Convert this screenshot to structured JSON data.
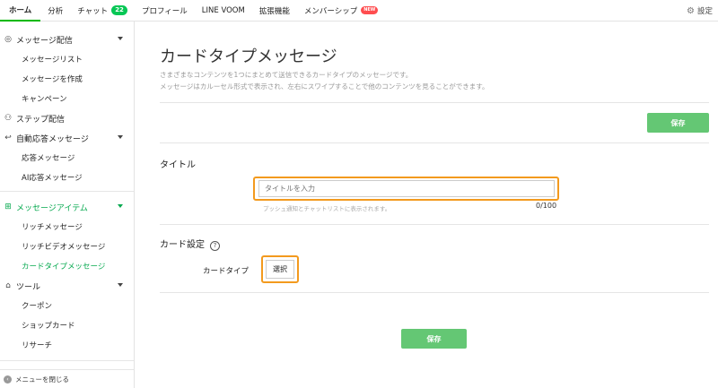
{
  "topnav": {
    "tabs": [
      {
        "label": "ホーム"
      },
      {
        "label": "分析"
      },
      {
        "label": "チャット",
        "badge": "22"
      },
      {
        "label": "プロフィール"
      },
      {
        "label": "LINE VOOM"
      },
      {
        "label": "拡張機能"
      },
      {
        "label": "メンバーシップ",
        "badge": "NEW"
      }
    ],
    "settings_label": "設定"
  },
  "sidebar": {
    "groups": [
      {
        "label": "メッセージ配信",
        "items": [
          "メッセージリスト",
          "メッセージを作成",
          "キャンペーン"
        ]
      },
      {
        "label": "ステップ配信"
      },
      {
        "label": "自動応答メッセージ",
        "items": [
          "応答メッセージ",
          "AI応答メッセージ"
        ]
      },
      {
        "label": "メッセージアイテム",
        "items": [
          "リッチメッセージ",
          "リッチビデオメッセージ",
          "カードタイプメッセージ"
        ]
      },
      {
        "label": "ツール",
        "items": [
          "クーポン",
          "ショップカード",
          "リサーチ"
        ]
      }
    ],
    "close_menu": "メニューを閉じる"
  },
  "main": {
    "title": "カードタイプメッセージ",
    "description": [
      "さまざまなコンテンツを1つにまとめて送信できるカードタイプのメッセージです。",
      "メッセージはカルーセル形式で表示され、左右にスワイプすることで他のコンテンツを見ることができます。"
    ],
    "save_label": "保存",
    "title_section": {
      "heading": "タイトル",
      "placeholder": "タイトルを入力",
      "hint": "プッシュ通知とチャットリストに表示されます。",
      "counter": "0/100"
    },
    "card_section": {
      "heading": "カード設定",
      "card_type_label": "カードタイプ",
      "select_label": "選択"
    },
    "footer_save_label": "保存"
  },
  "colors": {
    "brand_green": "#06c755",
    "save_button": "#64c774",
    "highlight_orange": "#f39a1e",
    "new_badge": "#ff4d4f"
  }
}
